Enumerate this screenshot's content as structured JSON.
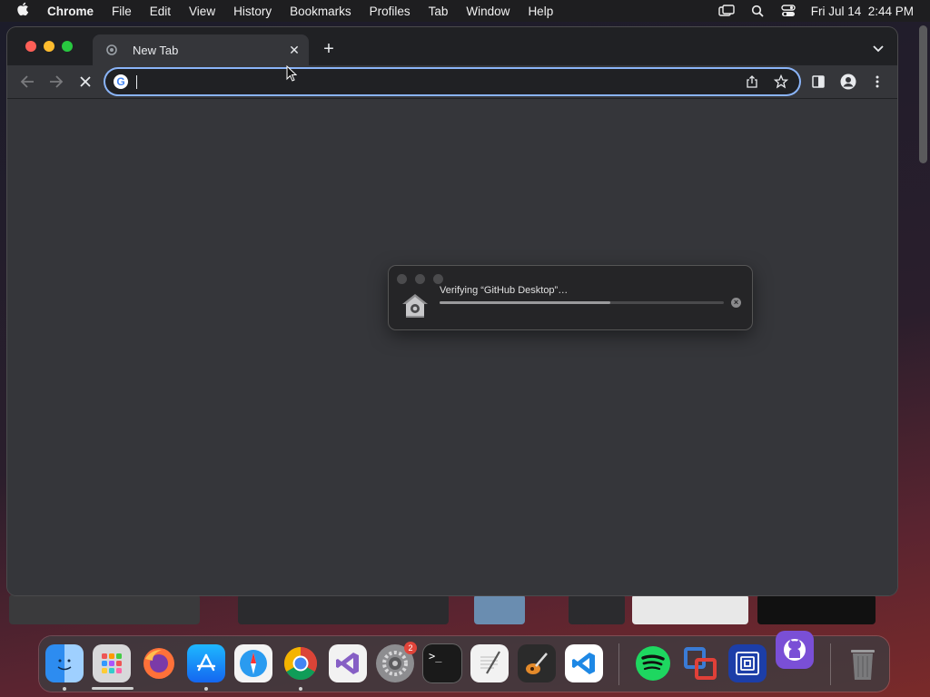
{
  "menubar": {
    "app_name": "Chrome",
    "items": [
      "File",
      "Edit",
      "View",
      "History",
      "Bookmarks",
      "Profiles",
      "Tab",
      "Window",
      "Help"
    ],
    "clock": "Fri Jul 14  2:44 PM"
  },
  "browser": {
    "tab_title": "New Tab",
    "omnibox_value": ""
  },
  "dialog": {
    "message": "Verifying “GitHub Desktop”…",
    "progress": 0.6
  },
  "dock": {
    "settings_badge": "2",
    "apps": [
      "Finder",
      "Launchpad",
      "Firefox",
      "App Store",
      "Safari",
      "Chrome",
      "Visual Studio",
      "System Settings",
      "Terminal",
      "TextEdit",
      "GarageBand",
      "Visual Studio Code",
      "Spotify",
      "VMware Fusion",
      "Parallels",
      "GitHub Desktop",
      "Trash"
    ]
  },
  "colors": {
    "accent": "#8ab4f8",
    "window_bg": "#35363a",
    "tabstrip_bg": "#202124",
    "close": "#ff5f57",
    "minimize": "#febc2e",
    "zoom": "#28c840"
  }
}
